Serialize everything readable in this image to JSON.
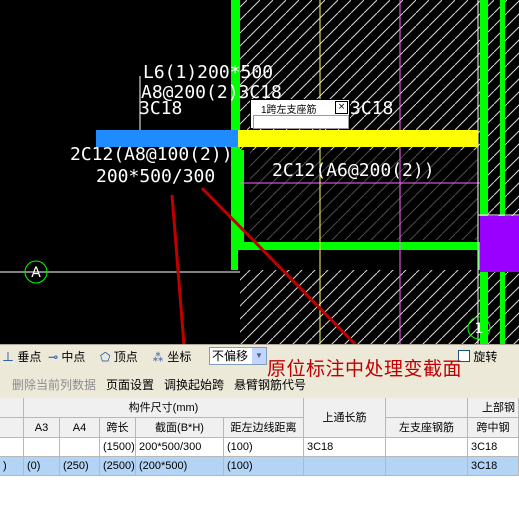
{
  "canvas": {
    "beam_label_line1": "L6(1)200*500",
    "beam_label_line2": "A8@200(2)3C18",
    "beam_label_line3": "3C18",
    "beam_label_line3b": "3C18",
    "left_rebar_label": "2C12(A8@100(2))",
    "left_section_label": "200*500/300",
    "right_rebar_label": "2C12(A6@200(2))",
    "axis_bubble_left": "A",
    "axis_bubble_bottom": "1",
    "tooltip_title": "1跨左支座筋",
    "tooltip_close": "×"
  },
  "toolbar": {
    "perpendicular": "垂点",
    "midpoint": "中点",
    "vertex": "顶点",
    "coordinate": "坐标",
    "offset_select": "不偏移",
    "rotate": "旋转"
  },
  "menubar": {
    "delete_column_data": "删除当前列数据",
    "page_setup": "页面设置",
    "adjust_start_span": "调换起始跨",
    "cantilever_code": "悬臂钢筋代号"
  },
  "annotation": "原位标注中处理变截面",
  "grid": {
    "group_header": "构件尺寸(mm)",
    "top_rebar_header": "上部钢",
    "columns": [
      "A3",
      "A4",
      "跨长",
      "截面(B*H)",
      "距左边线距离",
      "上通长筋",
      "左支座钢筋",
      "跨中钢"
    ],
    "rows": [
      [
        "",
        "",
        "",
        "(1500)",
        "200*500/300",
        "(100)",
        "3C18",
        "",
        "3C18"
      ],
      [
        ")",
        "(0)",
        "(250)",
        "(2500)",
        "(200*500)",
        "(100)",
        "",
        "",
        "3C18"
      ]
    ]
  }
}
